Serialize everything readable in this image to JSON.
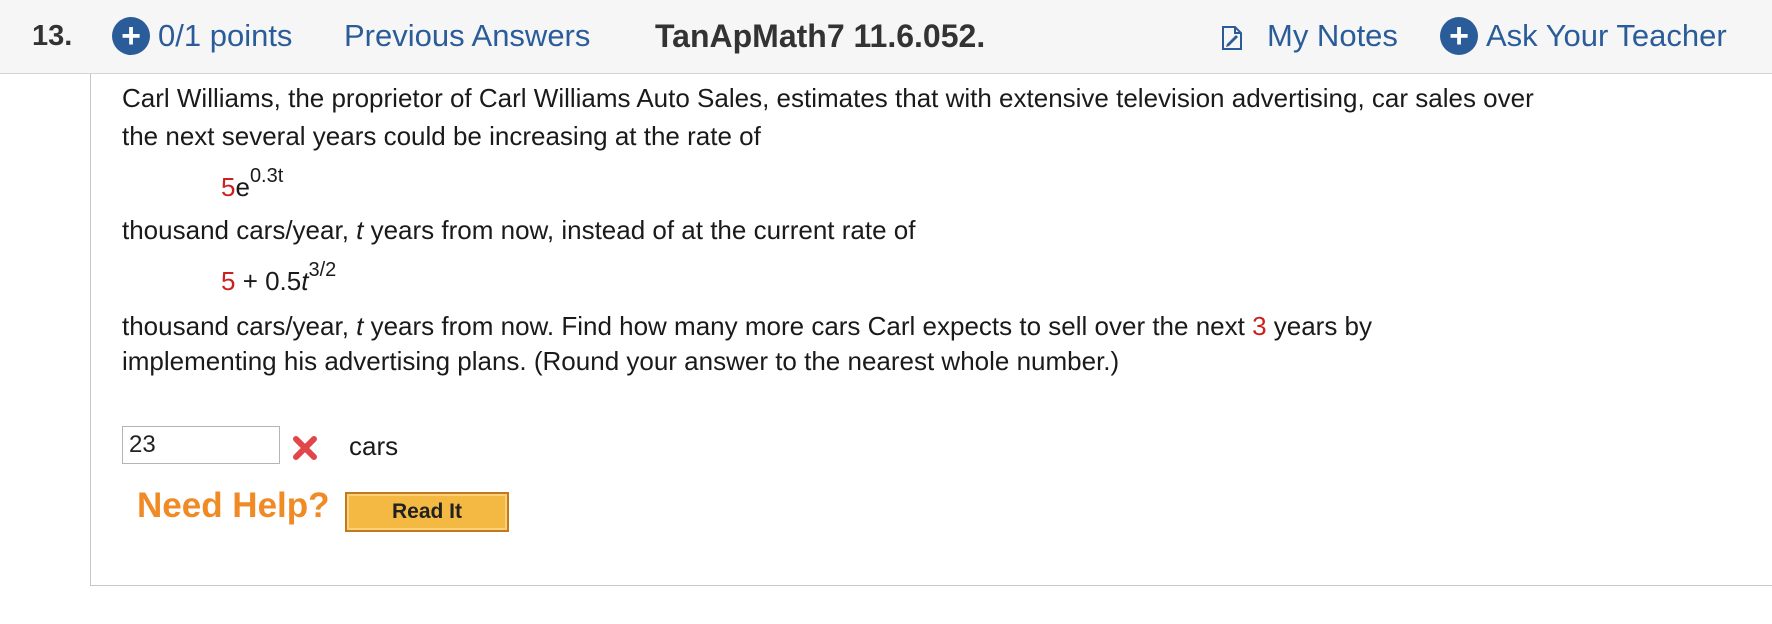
{
  "header": {
    "question_number": "13.",
    "points": "0/1 points",
    "previous_answers": "Previous Answers",
    "problem_code": "TanApMath7 11.6.052.",
    "my_notes": "My Notes",
    "ask_teacher": "Ask Your Teacher",
    "accent_color": "#2b5c9a"
  },
  "question": {
    "line1": "Carl Williams, the proprietor of Carl Williams Auto Sales, estimates that with extensive television advertising, car sales over",
    "line2": "the next several years could be increasing at the rate of",
    "formula1": {
      "coef": "5",
      "base": "e",
      "exponent": "0.3t"
    },
    "line3_pre": "thousand cars/year, ",
    "line3_var": "t",
    "line3_post": " years from now, instead of at the current rate of",
    "formula2": {
      "coef": "5",
      "rest": " + 0.5",
      "var": "t",
      "exponent": "3/2"
    },
    "line4_pre": "thousand cars/year, ",
    "line4_var": "t",
    "line4_mid": " years from now. Find how many more cars Carl expects to sell over the next ",
    "line4_years": "3",
    "line4_post": " years by",
    "line5": "implementing his advertising plans. (Round your answer to the nearest whole number.)"
  },
  "answer": {
    "value": "23",
    "status": "incorrect",
    "units": "cars"
  },
  "help": {
    "label": "Need Help?",
    "read_it": "Read It"
  }
}
